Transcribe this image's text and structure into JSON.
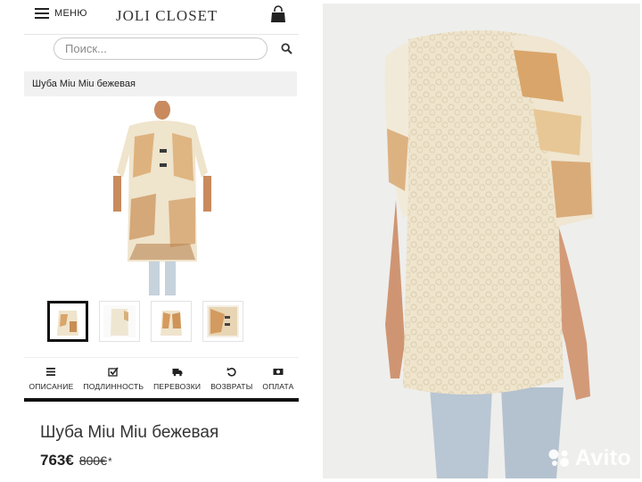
{
  "header": {
    "menu_label": "МЕНЮ",
    "logo_text": "JOLI CLOSET",
    "bag_icon": "shopping-bag-icon"
  },
  "search": {
    "placeholder": "Поиск...",
    "icon": "search-icon"
  },
  "breadcrumb": {
    "text": "Шуба Miu Miu бежевая"
  },
  "gallery": {
    "thumbnails_count": 4,
    "active_index": 0
  },
  "features": [
    {
      "icon": "list-icon",
      "label": "ОПИСАНИЕ"
    },
    {
      "icon": "check-icon",
      "label": "ПОДЛИННОСТЬ"
    },
    {
      "icon": "truck-icon",
      "label": "ПЕРЕВОЗКИ"
    },
    {
      "icon": "return-icon",
      "label": "ВОЗВРАТЫ"
    },
    {
      "icon": "payment-icon",
      "label": "ОПЛАТА"
    }
  ],
  "product": {
    "title": "Шуба Miu Miu бежевая",
    "price": "763€",
    "old_price": "800€",
    "old_price_mark": "*"
  },
  "watermark": {
    "text": "Avito"
  },
  "colors": {
    "fur_cream": "#efe4cc",
    "fur_ginger": "#d9a56a",
    "background_gray": "#eeeeec"
  }
}
